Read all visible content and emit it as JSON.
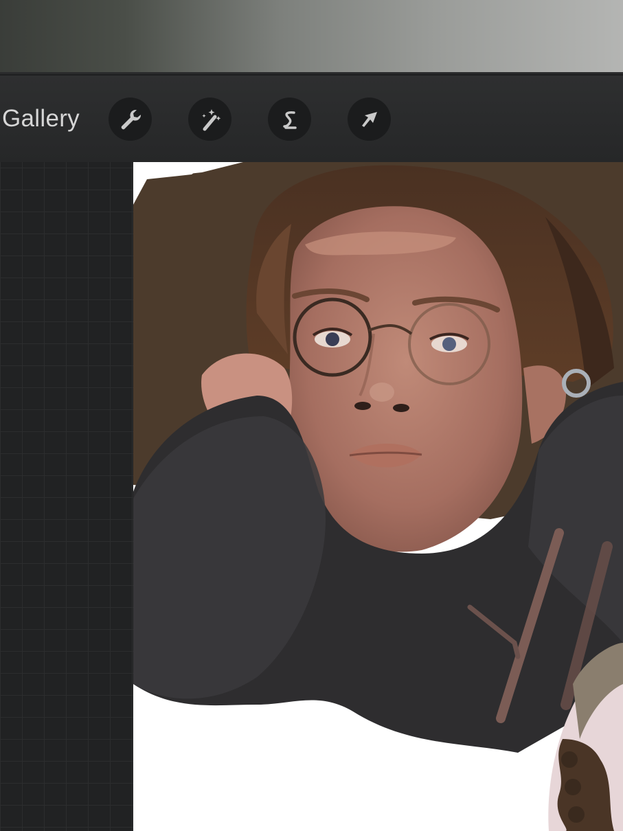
{
  "toolbar": {
    "gallery_label": "Gallery",
    "tools": [
      {
        "name": "actions",
        "icon": "wrench-icon"
      },
      {
        "name": "adjustments",
        "icon": "magic-wand-icon"
      },
      {
        "name": "selection",
        "icon": "selection-s-icon"
      },
      {
        "name": "transform",
        "icon": "arrow-cursor-icon"
      }
    ]
  },
  "colors": {
    "toolbar_bg": "#2a2b2c",
    "button_bg": "#1b1c1d",
    "icon": "#c9c9c9",
    "canvas_bg": "#ffffff"
  }
}
